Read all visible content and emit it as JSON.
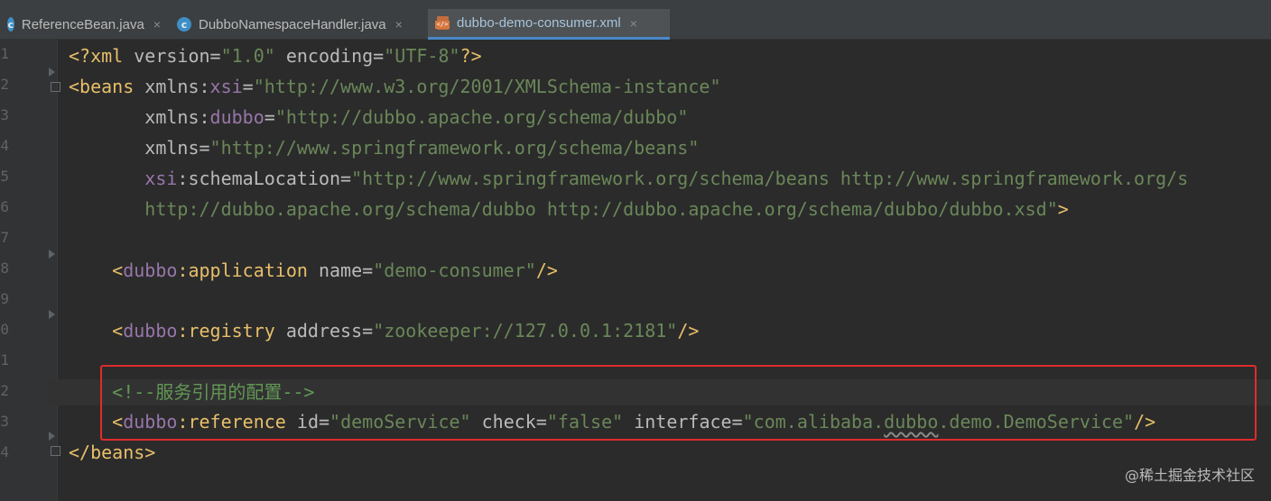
{
  "tabs": [
    {
      "label": "ReferenceBean.java",
      "icon": "java-class-icon",
      "active": false
    },
    {
      "label": "DubboNamespaceHandler.java",
      "icon": "java-class-icon",
      "active": false
    },
    {
      "label": "dubbo-demo-consumer.xml",
      "icon": "xml-file-icon",
      "active": true
    }
  ],
  "tab_close_glyph": "×",
  "class_icon_letter": "c",
  "line_numbers": [
    "1",
    "2",
    "3",
    "4",
    "5",
    "6",
    "7",
    "8",
    "9",
    "0",
    "1",
    "2",
    "3",
    "4"
  ],
  "code": {
    "l1": {
      "open": "<?",
      "name": "xml",
      "a1": " version=",
      "v1": "\"1.0\"",
      "a2": " encoding=",
      "v2": "\"UTF-8\"",
      "close": "?>"
    },
    "l2": {
      "open": "<beans",
      "a1": " xmlns:",
      "ns": "xsi",
      "eq": "=",
      "v1": "\"http://www.w3.org/2001/XMLSchema-instance\""
    },
    "l3": {
      "indent": "       ",
      "a1": "xmlns:",
      "ns": "dubbo",
      "eq": "=",
      "v1": "\"http://dubbo.apache.org/schema/dubbo\""
    },
    "l4": {
      "indent": "       ",
      "a1": "xmlns=",
      "v1": "\"http://www.springframework.org/schema/beans\""
    },
    "l5": {
      "indent": "       ",
      "ns": "xsi",
      "a1": ":schemaLocation=",
      "v1": "\"http://www.springframework.org/schema/beans http://www.springframework.org/s"
    },
    "l6": {
      "indent": "       ",
      "v1": "http://dubbo.apache.org/schema/dubbo http://dubbo.apache.org/schema/dubbo/dubbo.xsd\"",
      "close": ">"
    },
    "l8": {
      "indent": "    ",
      "lt": "<",
      "ns": "dubbo",
      "tag": ":application",
      "a1": " name=",
      "v1": "\"demo-consumer\"",
      "close": "/>"
    },
    "l10": {
      "indent": "    ",
      "lt": "<",
      "ns": "dubbo",
      "tag": ":registry",
      "a1": " address=",
      "v1": "\"zookeeper://127.0.0.1:2181\"",
      "close": "/>"
    },
    "l12": {
      "indent": "    ",
      "comment": "<!--服务引用的配置-->"
    },
    "l13": {
      "indent": "    ",
      "lt": "<",
      "ns": "dubbo",
      "tag": ":reference",
      "a1": " id=",
      "v1": "\"demoService\"",
      "a2": " check=",
      "v2": "\"false\"",
      "a3": " interface=",
      "v3a": "\"com.alibaba.",
      "v3b": "dubbo",
      "v3c": ".demo.DemoService\"",
      "close": "/>"
    },
    "l14": {
      "close": "</beans>"
    }
  },
  "watermark": "@稀土掘金技术社区",
  "colors": {
    "bg": "#2b2b2b",
    "tag": "#e8bf6a",
    "value": "#6a8759",
    "namespace": "#9876aa",
    "comment": "#629755",
    "highlight_box": "#e12b2b"
  }
}
